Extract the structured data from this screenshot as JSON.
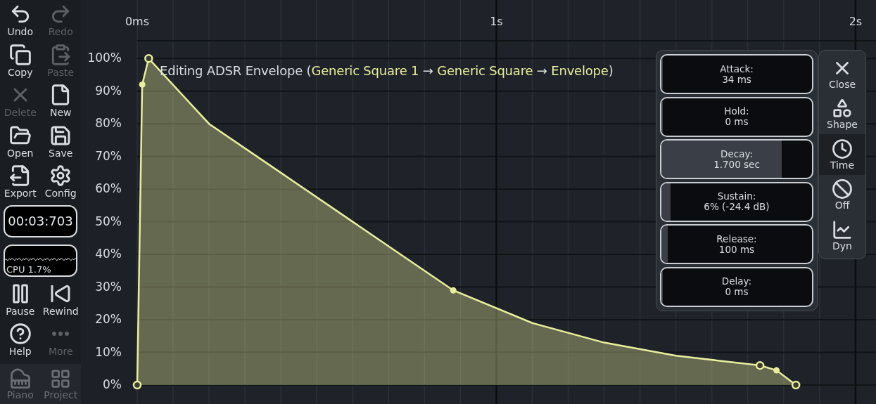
{
  "sidebar": {
    "tools": [
      {
        "label": "Undo",
        "disabled": false
      },
      {
        "label": "Redo",
        "disabled": true
      },
      {
        "label": "Copy",
        "disabled": false
      },
      {
        "label": "Paste",
        "disabled": true
      },
      {
        "label": "Delete",
        "disabled": true
      },
      {
        "label": "New",
        "disabled": false
      },
      {
        "label": "Open",
        "disabled": false
      },
      {
        "label": "Save",
        "disabled": false
      },
      {
        "label": "Export",
        "disabled": false
      },
      {
        "label": "Config",
        "disabled": false
      }
    ],
    "timer": "00:03:703",
    "cpu": "CPU 1.7%",
    "transport": [
      {
        "label": "Pause",
        "disabled": false
      },
      {
        "label": "Rewind",
        "disabled": false
      },
      {
        "label": "Help",
        "disabled": false
      },
      {
        "label": "More",
        "disabled": true
      }
    ],
    "bottom_tabs": [
      {
        "label": "Piano",
        "selected": false
      },
      {
        "label": "Project",
        "selected": false
      }
    ]
  },
  "editor": {
    "title": [
      {
        "text": "Editing ADSR Envelope (",
        "highlight": false
      },
      {
        "text": "Generic Square 1",
        "highlight": true
      },
      {
        "text": " → ",
        "highlight": false
      },
      {
        "text": "Generic Square",
        "highlight": true
      },
      {
        "text": " → ",
        "highlight": false
      },
      {
        "text": "Envelope",
        "highlight": true
      },
      {
        "text": ")",
        "highlight": false
      }
    ],
    "chart_data": {
      "type": "area",
      "x": [
        0,
        0.014,
        0.032,
        0.2,
        0.4,
        0.6,
        0.88,
        1.1,
        1.3,
        1.5,
        1.734,
        1.78,
        1.834
      ],
      "grid": true,
      "ref_lines": [
        {
          "axis": "x",
          "value": 1
        },
        {
          "axis": "x",
          "value": 2
        }
      ],
      "series": [
        {
          "color": "#e8ee9c",
          "values": [
            0,
            0.92,
            1.0,
            0.8,
            0.65,
            0.5,
            0.29,
            0.19,
            0.13,
            0.09,
            0.06,
            0.045,
            0
          ]
        }
      ],
      "xlim": [
        0,
        2.057
      ],
      "ylim": [
        -0.058,
        1.179
      ],
      "xticks": [
        {
          "value": 0,
          "label": "0ms"
        },
        {
          "value": 1,
          "label": "1s"
        },
        {
          "value": 2,
          "label": "2s"
        }
      ],
      "yticks": [
        {
          "value": 0,
          "label": "0%"
        },
        {
          "value": 0.1,
          "label": "10%"
        },
        {
          "value": 0.2,
          "label": "20%"
        },
        {
          "value": 0.3,
          "label": "30%"
        },
        {
          "value": 0.4,
          "label": "40%"
        },
        {
          "value": 0.5,
          "label": "50%"
        },
        {
          "value": 0.6,
          "label": "60%"
        },
        {
          "value": 0.7,
          "label": "70%"
        },
        {
          "value": 0.8,
          "label": "80%"
        },
        {
          "value": 0.9,
          "label": "90%"
        },
        {
          "value": 1,
          "label": "100%"
        }
      ]
    },
    "points": [
      {
        "kind": "node"
      },
      {
        "kind": "control"
      },
      {
        "kind": "node"
      },
      {
        "kind": "curve"
      },
      {
        "kind": "curve"
      },
      {
        "kind": "curve"
      },
      {
        "kind": "control"
      },
      {
        "kind": "curve"
      },
      {
        "kind": "curve"
      },
      {
        "kind": "curve"
      },
      {
        "kind": "node"
      },
      {
        "kind": "control"
      },
      {
        "kind": "node"
      }
    ],
    "params": [
      {
        "name": "Attack:",
        "value": "34 ms",
        "level": 0.01
      },
      {
        "name": "Hold:",
        "value": "0 ms",
        "level": 0
      },
      {
        "name": "Decay:",
        "value": "1.700 sec",
        "level": 0.8
      },
      {
        "name": "Sustain:",
        "value": "6% (-24.4 dB)",
        "level": 0.06
      },
      {
        "name": "Release:",
        "value": "100 ms",
        "level": 0.04
      },
      {
        "name": "Delay:",
        "value": "0 ms",
        "level": 0
      }
    ],
    "side_tabs": [
      {
        "label": "Close",
        "selected": false
      },
      {
        "label": "Shape",
        "selected": false
      },
      {
        "label": "Time",
        "selected": true
      },
      {
        "label": "Off",
        "selected": false
      },
      {
        "label": "Dyn",
        "selected": false
      }
    ]
  }
}
